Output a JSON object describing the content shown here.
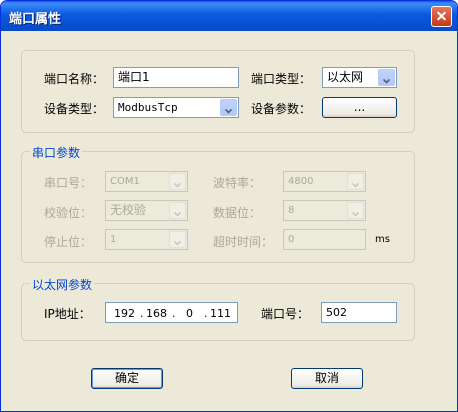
{
  "window": {
    "title": "端口属性"
  },
  "general": {
    "port_name_label": "端口名称：",
    "port_name_value": "端口1",
    "port_type_label": "端口类型：",
    "port_type_value": "以太网",
    "device_type_label": "设备类型：",
    "device_type_value": "ModbusTcp",
    "device_params_label": "设备参数：",
    "device_params_button": "..."
  },
  "serial": {
    "title": "串口参数",
    "port_no_label": "串口号：",
    "port_no_value": "COM1",
    "baud_label": "波特率：",
    "baud_value": "4800",
    "parity_label": "校验位：",
    "parity_value": "无校验",
    "data_bits_label": "数据位：",
    "data_bits_value": "8",
    "stop_bits_label": "停止位：",
    "stop_bits_value": "1",
    "timeout_label": "超时时间：",
    "timeout_value": "0",
    "timeout_unit": "ms"
  },
  "ethernet": {
    "title": "以太网参数",
    "ip_label": "IP地址：",
    "ip_octets": [
      "192",
      "168",
      "0",
      "111"
    ],
    "port_label": "端口号：",
    "port_value": "502"
  },
  "buttons": {
    "ok": "确定",
    "cancel": "取消"
  }
}
